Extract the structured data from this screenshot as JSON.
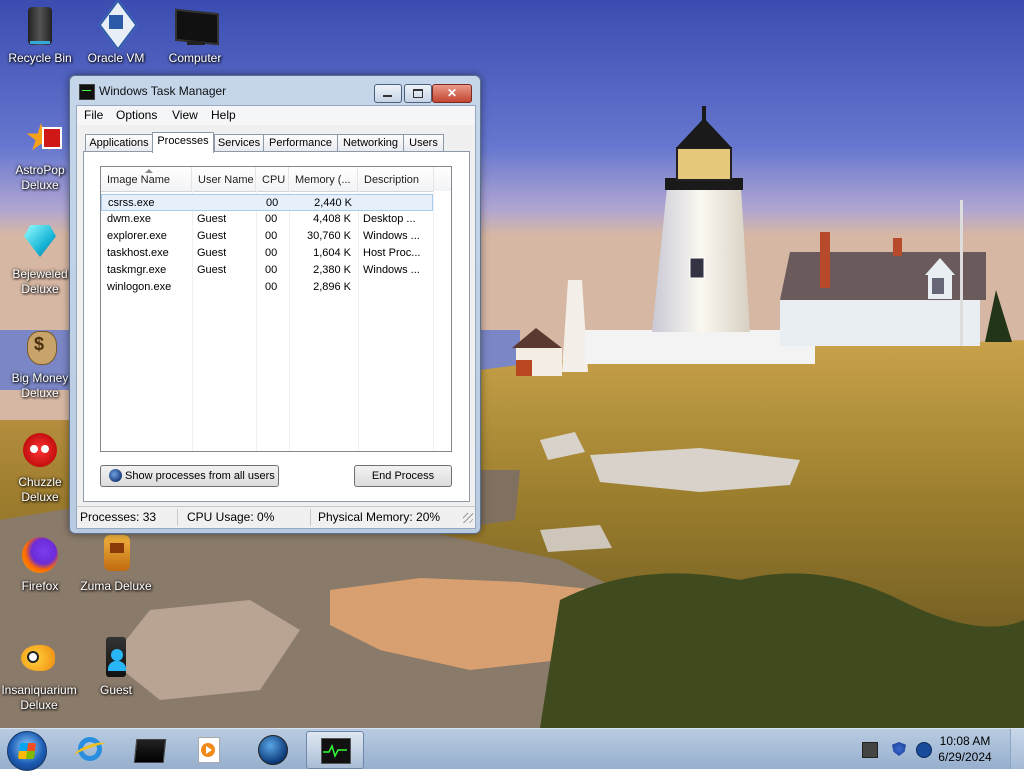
{
  "desktop": {
    "icons": [
      {
        "label": "Recycle Bin",
        "icon": "recycle-bin-icon"
      },
      {
        "label": "Oracle VM",
        "icon": "virtualbox-icon"
      },
      {
        "label": "Computer",
        "icon": "computer-icon"
      },
      {
        "label": "AstroPop Deluxe",
        "icon": "astropop-icon"
      },
      {
        "label": "Bejeweled Deluxe",
        "icon": "bejeweled-icon"
      },
      {
        "label": "Big Money Deluxe",
        "icon": "big-money-icon"
      },
      {
        "label": "Chuzzle Deluxe",
        "icon": "chuzzle-icon"
      },
      {
        "label": "Firefox",
        "icon": "firefox-icon"
      },
      {
        "label": "Zuma Deluxe",
        "icon": "zuma-icon"
      },
      {
        "label": "Insaniquarium Deluxe",
        "icon": "insaniquarium-icon"
      },
      {
        "label": "Guest",
        "icon": "user-folder-icon"
      }
    ]
  },
  "taskmgr": {
    "title": "Windows Task Manager",
    "menu": [
      "File",
      "Options",
      "View",
      "Help"
    ],
    "tabs": [
      "Applications",
      "Processes",
      "Services",
      "Performance",
      "Networking",
      "Users"
    ],
    "active_tab": "Processes",
    "columns": [
      "Image Name",
      "User Name",
      "CPU",
      "Memory (...",
      "Description"
    ],
    "rows": [
      {
        "image": "csrss.exe",
        "user": "",
        "cpu": "00",
        "memory": "2,440 K",
        "description": ""
      },
      {
        "image": "dwm.exe",
        "user": "Guest",
        "cpu": "00",
        "memory": "4,408 K",
        "description": "Desktop ..."
      },
      {
        "image": "explorer.exe",
        "user": "Guest",
        "cpu": "00",
        "memory": "30,760 K",
        "description": "Windows ..."
      },
      {
        "image": "taskhost.exe",
        "user": "Guest",
        "cpu": "00",
        "memory": "1,604 K",
        "description": "Host Proc..."
      },
      {
        "image": "taskmgr.exe",
        "user": "Guest",
        "cpu": "00",
        "memory": "2,380 K",
        "description": "Windows ..."
      },
      {
        "image": "winlogon.exe",
        "user": "",
        "cpu": "00",
        "memory": "2,896 K",
        "description": ""
      }
    ],
    "show_all_label": "Show processes from all users",
    "end_process_label": "End Process",
    "status": {
      "processes": "Processes: 33",
      "cpu": "CPU Usage: 0%",
      "memory": "Physical Memory: 20%"
    }
  },
  "taskbar": {
    "pinned": [
      "internet-explorer-icon",
      "terminal-icon",
      "media-player-icon",
      "globe-icon",
      "task-manager-icon"
    ],
    "clock_time": "10:08 AM",
    "clock_date": "6/29/2024"
  },
  "colors": {
    "sky_top": "#3c4fb3",
    "taskbar": "#a7bdd8",
    "window_frame": "#b9cbe2",
    "close_button": "#c44531",
    "selection": "#e6f0fb"
  }
}
